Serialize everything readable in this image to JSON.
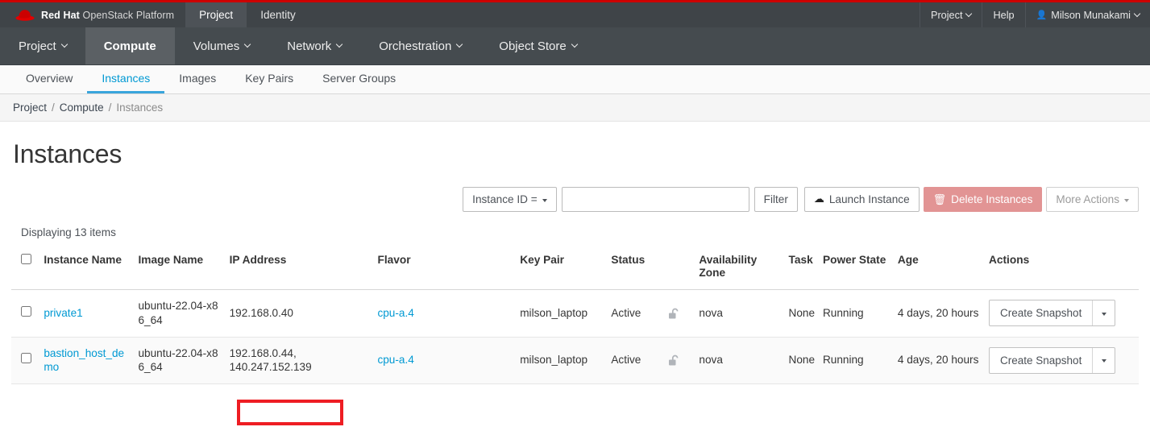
{
  "masthead": {
    "brand_bold": "Red Hat",
    "brand_rest": " OpenStack Platform",
    "logo_icon": "redhat-hat-icon",
    "tabs": [
      {
        "label": "Project",
        "active": true
      },
      {
        "label": "Identity",
        "active": false
      }
    ],
    "right": {
      "project_label": "Project",
      "help_label": "Help",
      "user_label": "Milson Munakami",
      "user_icon": "user-icon",
      "chevron_icon": "chevron-down-icon"
    }
  },
  "primary_nav": {
    "items": [
      {
        "label": "Project",
        "active": false,
        "caret": true
      },
      {
        "label": "Compute",
        "active": true,
        "caret": false
      },
      {
        "label": "Volumes",
        "active": false,
        "caret": true
      },
      {
        "label": "Network",
        "active": false,
        "caret": true
      },
      {
        "label": "Orchestration",
        "active": false,
        "caret": true
      },
      {
        "label": "Object Store",
        "active": false,
        "caret": true
      }
    ]
  },
  "secondary_tabs": {
    "items": [
      {
        "label": "Overview",
        "active": false
      },
      {
        "label": "Instances",
        "active": true
      },
      {
        "label": "Images",
        "active": false
      },
      {
        "label": "Key Pairs",
        "active": false
      },
      {
        "label": "Server Groups",
        "active": false
      }
    ]
  },
  "breadcrumb": {
    "items": [
      "Project",
      "Compute",
      "Instances"
    ],
    "separator": "/"
  },
  "page": {
    "title": "Instances",
    "count_text": "Displaying 13 items"
  },
  "toolbar": {
    "filter_select_label": "Instance ID =",
    "filter_input_value": "",
    "filter_input_placeholder": "",
    "filter_button": "Filter",
    "launch_button": "Launch Instance",
    "launch_icon": "cloud-upload-icon",
    "delete_button": "Delete Instances",
    "delete_icon": "trash-icon",
    "more_actions_button": "More Actions",
    "colors": {
      "delete_bg": "#e29494",
      "link": "#0099d3",
      "accent_red": "#cc0000",
      "annotation_red": "#ee1d23"
    }
  },
  "table": {
    "headers": [
      "Instance Name",
      "Image Name",
      "IP Address",
      "Flavor",
      "Key Pair",
      "Status",
      "Availability Zone",
      "Task",
      "Power State",
      "Age",
      "Actions"
    ],
    "rows": [
      {
        "name": "private1",
        "image_name": "ubuntu-22.04-x86_64",
        "ip_address": "192.168.0.40",
        "flavor": "cpu-a.4",
        "key_pair": "milson_laptop",
        "status": "Active",
        "lock_icon": "unlocked-padlock-icon",
        "availability_zone": "nova",
        "task": "None",
        "power_state": "Running",
        "age": "4 days, 20 hours",
        "action_label": "Create Snapshot"
      },
      {
        "name": "bastion_host_demo",
        "image_name": "ubuntu-22.04-x86_64",
        "ip_address": "192.168.0.44, 140.247.152.139",
        "ip_primary": "192.168.0.44,",
        "ip_secondary": "140.247.152.139",
        "flavor": "cpu-a.4",
        "key_pair": "milson_laptop",
        "status": "Active",
        "lock_icon": "unlocked-padlock-icon",
        "availability_zone": "nova",
        "task": "None",
        "power_state": "Running",
        "age": "4 days, 20 hours",
        "action_label": "Create Snapshot"
      }
    ]
  },
  "annotation": {
    "target_text": "140.247.152.139",
    "shape": "rectangle",
    "color": "#ee1d23"
  }
}
